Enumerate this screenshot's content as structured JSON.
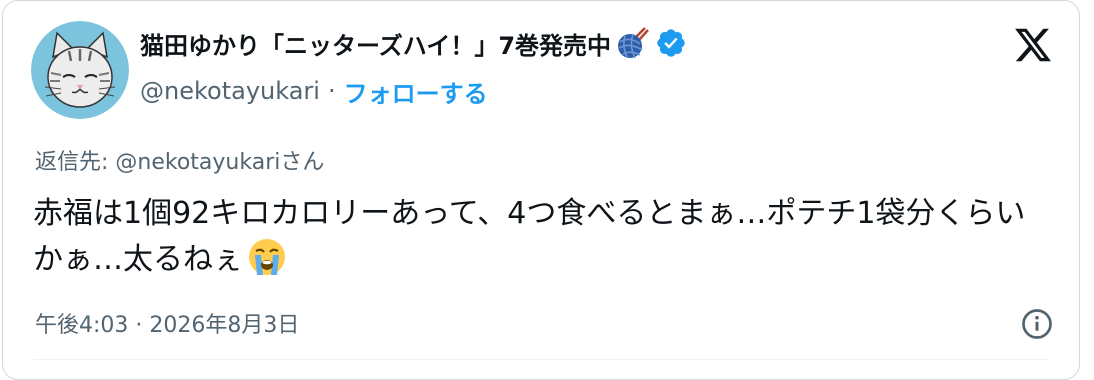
{
  "author": {
    "display_name": "猫田ゆかり「ニッターズハイ！」7巻発売中",
    "name_emoji": "yarn-ball-with-needles-icon",
    "verified_icon": "verified-badge-icon",
    "handle": "@nekotayukari",
    "separator": "·",
    "follow_label": "フォローする",
    "avatar": "cat-illustration-avatar"
  },
  "platform_icon": "x-logo-icon",
  "tweet": {
    "reply_to_prefix": "返信先: ",
    "reply_to_handle": "@nekotayukari",
    "reply_to_suffix": "さん",
    "text": "赤福は1個92キロカロリーあって、4つ食べるとまぁ…ポテチ1袋分くらいかぁ…太るねぇ",
    "trailing_emoji": "loudly-crying-face-icon",
    "timestamp": "午後4:03 · 2026年8月3日",
    "info_icon": "info-icon"
  },
  "colors": {
    "accent": "#1d9bf0",
    "text_primary": "#0f1419",
    "text_secondary": "#536471",
    "border": "#cfd9de",
    "avatar_bg": "#7cc3de"
  }
}
